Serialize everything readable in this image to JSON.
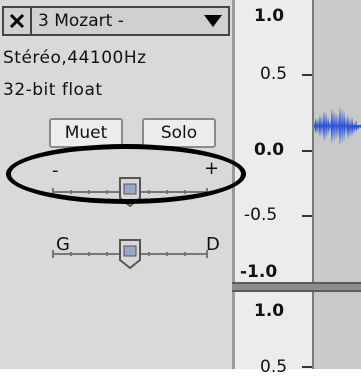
{
  "track": {
    "name": "3 Mozart -",
    "info_line_1": "Stéréo,44100Hz",
    "info_line_2": "32-bit float"
  },
  "buttons": {
    "mute_label": "Muet",
    "solo_label": "Solo"
  },
  "gain_slider": {
    "minus_label": "-",
    "plus_label": "+",
    "level": 0.5
  },
  "pan_slider": {
    "left_label": "G",
    "right_label": "D",
    "level": 0.5
  },
  "ruler": {
    "ticks": [
      "1.0",
      "0.5",
      "0.0",
      "-0.5",
      "-1.0"
    ],
    "next_track_ticks": [
      "1.0",
      "0.5"
    ]
  },
  "colors": {
    "waveform": "#2f56d9",
    "highlight": "#000000"
  },
  "icons": {
    "close": "close-icon",
    "dropdown": "triangle-down-icon"
  }
}
